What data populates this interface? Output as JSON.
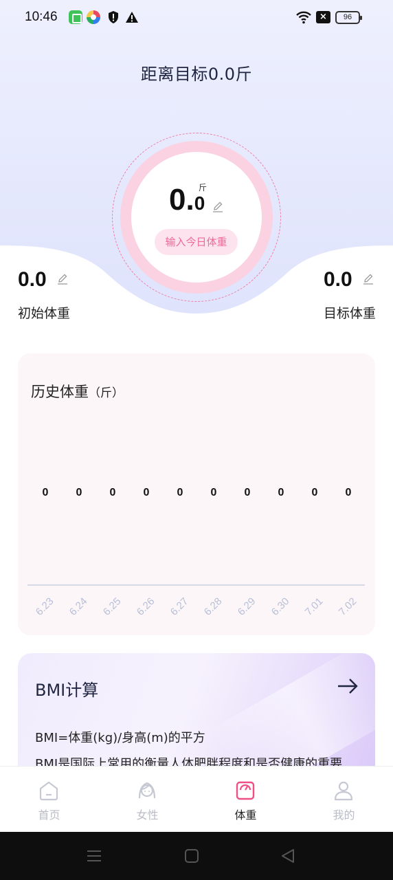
{
  "status_bar": {
    "time": "10:46",
    "battery": "96"
  },
  "header": {
    "goal_text": "距离目标0.0斤"
  },
  "current": {
    "weight_int": "0.",
    "weight_dec": "0",
    "unit": "斤",
    "input_button": "输入今日体重"
  },
  "start_weight": {
    "value": "0.0",
    "label": "初始体重"
  },
  "target_weight": {
    "value": "0.0",
    "label": "目标体重"
  },
  "history": {
    "title": "历史体重",
    "unit": "（斤）"
  },
  "chart_data": {
    "type": "line",
    "title": "历史体重（斤）",
    "categories": [
      "6.23",
      "6.24",
      "6.25",
      "6.26",
      "6.27",
      "6.28",
      "6.29",
      "6.30",
      "7.01",
      "7.02"
    ],
    "series": [
      {
        "values": [
          0,
          0,
          0,
          0,
          0,
          0,
          0,
          0,
          0,
          0
        ]
      }
    ],
    "data_labels": [
      "0",
      "0",
      "0",
      "0",
      "0",
      "0",
      "0",
      "0",
      "0",
      "0"
    ],
    "xlabel": "",
    "ylabel": "",
    "grid": false
  },
  "bmi": {
    "title": "BMI计算",
    "formula": "BMI=体重(kg)/身高(m)的平方",
    "description": "BMI是国际上常用的衡量人体肥胖程度和是否健康的重要"
  },
  "tabs": [
    {
      "label": "首页",
      "icon": "home-icon",
      "active": false
    },
    {
      "label": "女性",
      "icon": "woman-icon",
      "active": false
    },
    {
      "label": "体重",
      "icon": "scale-icon",
      "active": true
    },
    {
      "label": "我的",
      "icon": "person-icon",
      "active": false
    }
  ],
  "colors": {
    "accent_pink": "#ee6a96",
    "ring_pink": "#fbd2e1",
    "hero_lavender": "#e3e6fd",
    "axis_label": "#b6bfd8"
  }
}
